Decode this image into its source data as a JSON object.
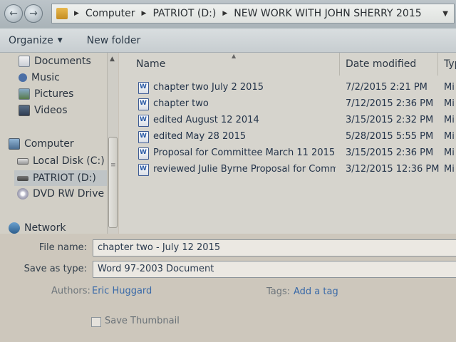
{
  "address": {
    "crumbs": [
      "Computer",
      "PATRIOT (D:)",
      "NEW WORK WITH JOHN SHERRY 2015"
    ],
    "back_icon": "back-arrow-icon",
    "forward_icon": "forward-arrow-icon"
  },
  "toolbar": {
    "organize_label": "Organize",
    "new_folder_label": "New folder"
  },
  "nav": {
    "libraries": [
      "Documents",
      "Music",
      "Pictures",
      "Videos"
    ],
    "computer_label": "Computer",
    "drives": [
      "Local Disk (C:)",
      "PATRIOT (D:)",
      "DVD RW Drive (F:"
    ],
    "network_label": "Network"
  },
  "columns": {
    "name": "Name",
    "date": "Date modified",
    "type": "Typ"
  },
  "files": [
    {
      "name": "chapter two July 2 2015",
      "date": "7/2/2015 2:21 PM",
      "type": "Mi"
    },
    {
      "name": "chapter two",
      "date": "7/12/2015 2:36 PM",
      "type": "Mi"
    },
    {
      "name": "edited August 12 2014",
      "date": "3/15/2015 2:32 PM",
      "type": "Mi"
    },
    {
      "name": "edited May 28 2015",
      "date": "5/28/2015 5:55 PM",
      "type": "Mi"
    },
    {
      "name": "Proposal for Committee March 11 2015",
      "date": "3/15/2015 2:36 PM",
      "type": "Mi"
    },
    {
      "name": "reviewed Julie Byrne Proposal for Commi...",
      "date": "3/12/2015 12:36 PM",
      "type": "Mi"
    }
  ],
  "save": {
    "file_name_label": "File name:",
    "file_name_value": "chapter two - July 12 2015",
    "save_type_label": "Save as type:",
    "save_type_value": "Word 97-2003 Document",
    "authors_label": "Authors:",
    "authors_value": "Eric Huggard",
    "tags_label": "Tags:",
    "tags_value": "Add a tag",
    "thumbnail_label": "Save Thumbnail"
  }
}
